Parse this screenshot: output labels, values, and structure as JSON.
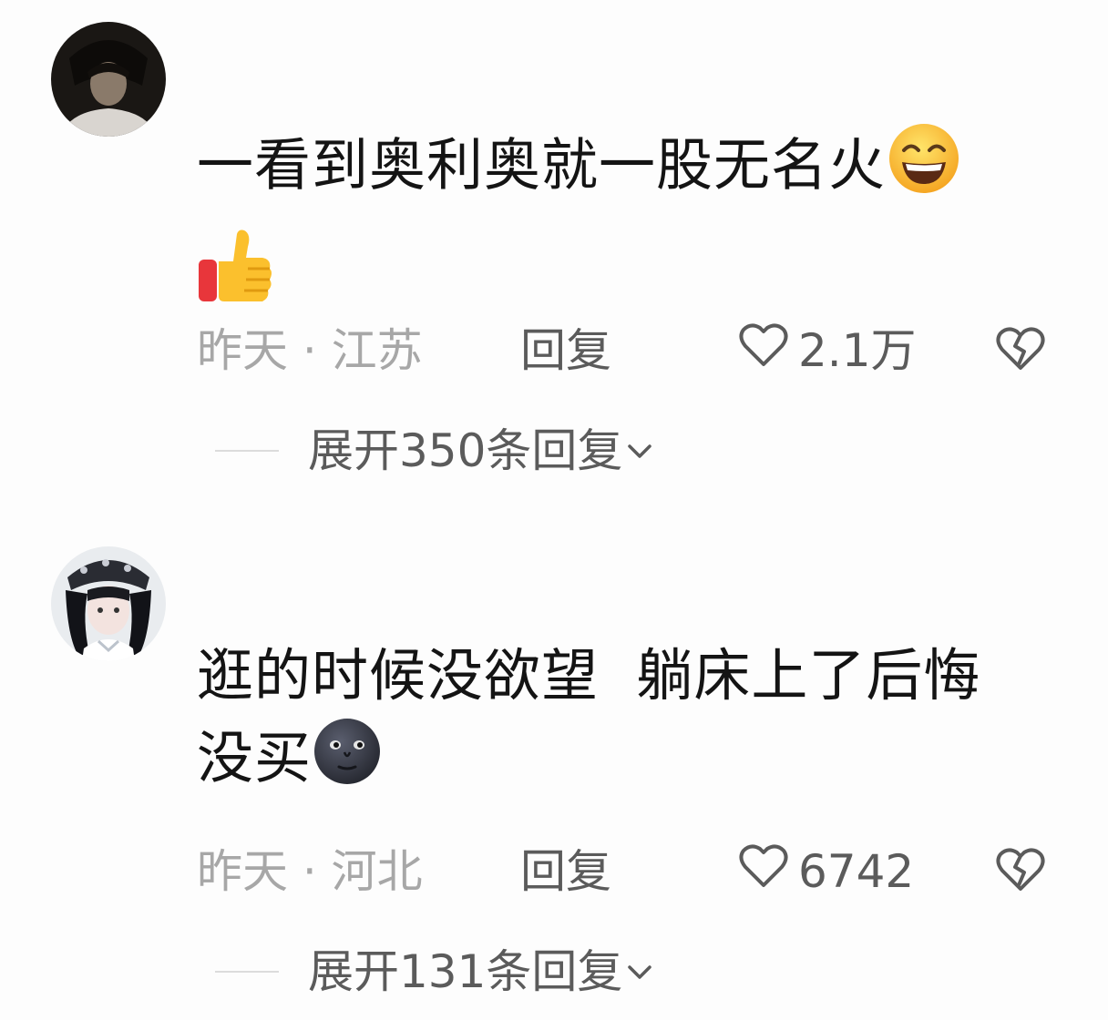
{
  "comments": [
    {
      "avatar_icon": "user-avatar-dark-photo",
      "text": "一看到奥利奥就一股无名火",
      "emojis": [
        "grinning-squinting-face-emoji",
        "thumbs-up-emoji"
      ],
      "time_location": "昨天 · 江苏",
      "reply_label": "回复",
      "like_count": "2.1万",
      "expand_label": "展开350条回复"
    },
    {
      "avatar_icon": "user-avatar-girl-photo",
      "text_line1": "逛的时候没欲望  躺床上了后悔",
      "text_line2": "没买",
      "emojis": [
        "new-moon-face-emoji"
      ],
      "time_location": "昨天 · 河北",
      "reply_label": "回复",
      "like_count": "6742",
      "expand_label": "展开131条回复"
    }
  ],
  "colors": {
    "background": "#fdfdfd",
    "text": "#141414",
    "meta": "#a7a7a7",
    "secondary": "#5b5b5b"
  }
}
